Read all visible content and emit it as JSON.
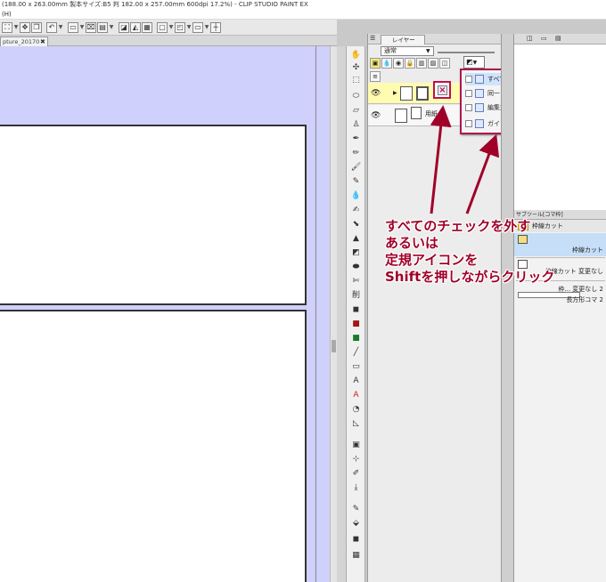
{
  "window": {
    "title": "(188.00 x 263.00mm 製本サイズ:B5 判 182.00 x 257.00mm 600dpi 17.2%) - CLIP STUDIO PAINT EX",
    "menu_fragment": "(H)"
  },
  "canvas": {
    "doc_tab": "pture_20170",
    "doc_tab_close": "✖",
    "background_color": "#cfd0fb"
  },
  "layer_panel": {
    "tab_label": "レイヤー",
    "blend_mode": "通常",
    "layer_name_partial": "用紙"
  },
  "popup_menu": {
    "items": [
      {
        "label": "すべてのレイヤーで表示"
      },
      {
        "label": "同一フォルダー内で表示"
      },
      {
        "label": "編集対象のときのみ表示"
      },
      {
        "label": "ガイドを定規にリンク"
      }
    ]
  },
  "sub_tool_panel": {
    "tab_label": "サブツール[コマ枠]",
    "tab_label_short": "枠線カット",
    "group_name": "枠線カット",
    "items": [
      {
        "label": "枠線カット"
      },
      {
        "label": "枠線カット 変更なし"
      },
      {
        "label": "枠... 変更なし 2"
      },
      {
        "label": "長方形コマ 2"
      }
    ]
  },
  "annotation": {
    "lines": [
      "すべてのチェックを外す",
      "あるいは",
      "定規アイコンを",
      "Shiftを押しながらクリック"
    ],
    "color": "#a00028"
  },
  "accent_colors": {
    "highlight_border": "#b0164f",
    "active_layer_bg": "#fffbb0",
    "selection_bg": "#c6def7"
  }
}
